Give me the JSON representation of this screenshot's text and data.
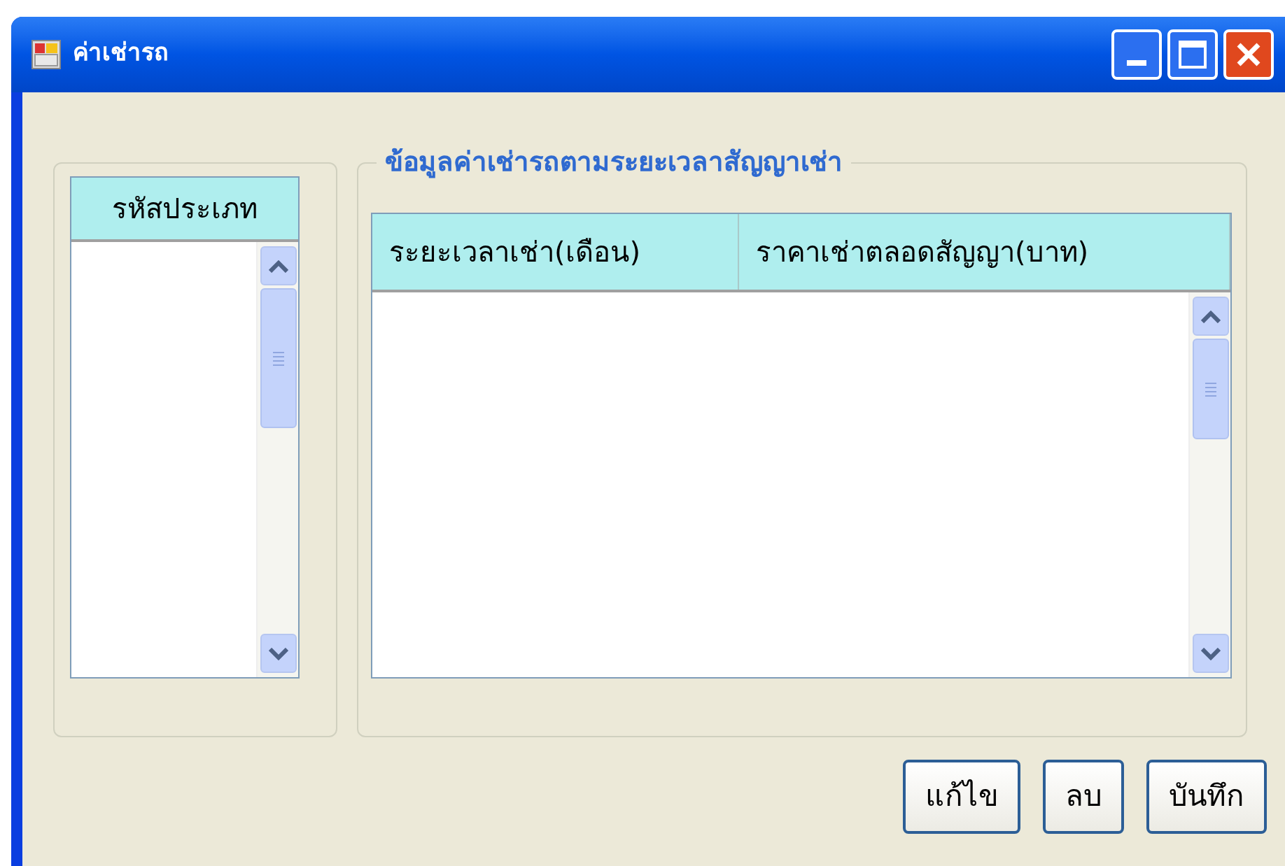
{
  "window": {
    "title": "ค่าเช่ารถ"
  },
  "type_list": {
    "column": "รหัสประเภท"
  },
  "rate_group": {
    "title": "ข้อมูลค่าเช่ารถตามระยะเวลาสัญญาเช่า",
    "columns": [
      "ระยะเวลาเช่า(เดือน)",
      "ราคาเช่าตลอดสัญญา(บาท)"
    ]
  },
  "buttons": [
    "แก้ไข",
    "ลบ",
    "บันทึก"
  ]
}
